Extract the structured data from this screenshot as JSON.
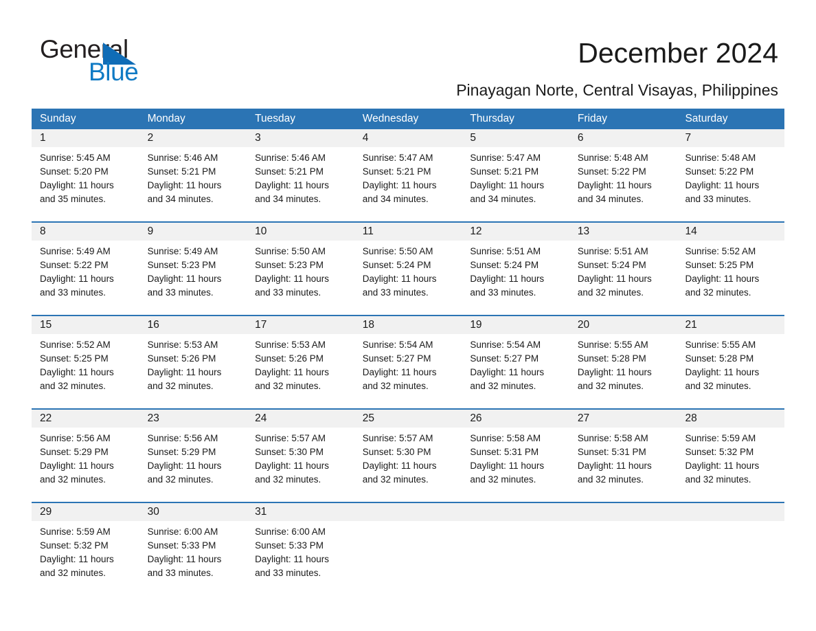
{
  "brand": {
    "logo_top": "General",
    "logo_bottom": "Blue",
    "accent_color": "#0f7ac4",
    "triangle_color": "#0f6cb6"
  },
  "header": {
    "title": "December 2024",
    "subtitle": "Pinayagan Norte, Central Visayas, Philippines"
  },
  "calendar": {
    "header_color": "#2b74b4",
    "date_band_color": "#f1f1f1",
    "weekdays": [
      "Sunday",
      "Monday",
      "Tuesday",
      "Wednesday",
      "Thursday",
      "Friday",
      "Saturday"
    ],
    "weeks": [
      [
        {
          "day": "1",
          "lines": [
            "Sunrise: 5:45 AM",
            "Sunset: 5:20 PM",
            "Daylight: 11 hours",
            "and 35 minutes."
          ]
        },
        {
          "day": "2",
          "lines": [
            "Sunrise: 5:46 AM",
            "Sunset: 5:21 PM",
            "Daylight: 11 hours",
            "and 34 minutes."
          ]
        },
        {
          "day": "3",
          "lines": [
            "Sunrise: 5:46 AM",
            "Sunset: 5:21 PM",
            "Daylight: 11 hours",
            "and 34 minutes."
          ]
        },
        {
          "day": "4",
          "lines": [
            "Sunrise: 5:47 AM",
            "Sunset: 5:21 PM",
            "Daylight: 11 hours",
            "and 34 minutes."
          ]
        },
        {
          "day": "5",
          "lines": [
            "Sunrise: 5:47 AM",
            "Sunset: 5:21 PM",
            "Daylight: 11 hours",
            "and 34 minutes."
          ]
        },
        {
          "day": "6",
          "lines": [
            "Sunrise: 5:48 AM",
            "Sunset: 5:22 PM",
            "Daylight: 11 hours",
            "and 34 minutes."
          ]
        },
        {
          "day": "7",
          "lines": [
            "Sunrise: 5:48 AM",
            "Sunset: 5:22 PM",
            "Daylight: 11 hours",
            "and 33 minutes."
          ]
        }
      ],
      [
        {
          "day": "8",
          "lines": [
            "Sunrise: 5:49 AM",
            "Sunset: 5:22 PM",
            "Daylight: 11 hours",
            "and 33 minutes."
          ]
        },
        {
          "day": "9",
          "lines": [
            "Sunrise: 5:49 AM",
            "Sunset: 5:23 PM",
            "Daylight: 11 hours",
            "and 33 minutes."
          ]
        },
        {
          "day": "10",
          "lines": [
            "Sunrise: 5:50 AM",
            "Sunset: 5:23 PM",
            "Daylight: 11 hours",
            "and 33 minutes."
          ]
        },
        {
          "day": "11",
          "lines": [
            "Sunrise: 5:50 AM",
            "Sunset: 5:24 PM",
            "Daylight: 11 hours",
            "and 33 minutes."
          ]
        },
        {
          "day": "12",
          "lines": [
            "Sunrise: 5:51 AM",
            "Sunset: 5:24 PM",
            "Daylight: 11 hours",
            "and 33 minutes."
          ]
        },
        {
          "day": "13",
          "lines": [
            "Sunrise: 5:51 AM",
            "Sunset: 5:24 PM",
            "Daylight: 11 hours",
            "and 32 minutes."
          ]
        },
        {
          "day": "14",
          "lines": [
            "Sunrise: 5:52 AM",
            "Sunset: 5:25 PM",
            "Daylight: 11 hours",
            "and 32 minutes."
          ]
        }
      ],
      [
        {
          "day": "15",
          "lines": [
            "Sunrise: 5:52 AM",
            "Sunset: 5:25 PM",
            "Daylight: 11 hours",
            "and 32 minutes."
          ]
        },
        {
          "day": "16",
          "lines": [
            "Sunrise: 5:53 AM",
            "Sunset: 5:26 PM",
            "Daylight: 11 hours",
            "and 32 minutes."
          ]
        },
        {
          "day": "17",
          "lines": [
            "Sunrise: 5:53 AM",
            "Sunset: 5:26 PM",
            "Daylight: 11 hours",
            "and 32 minutes."
          ]
        },
        {
          "day": "18",
          "lines": [
            "Sunrise: 5:54 AM",
            "Sunset: 5:27 PM",
            "Daylight: 11 hours",
            "and 32 minutes."
          ]
        },
        {
          "day": "19",
          "lines": [
            "Sunrise: 5:54 AM",
            "Sunset: 5:27 PM",
            "Daylight: 11 hours",
            "and 32 minutes."
          ]
        },
        {
          "day": "20",
          "lines": [
            "Sunrise: 5:55 AM",
            "Sunset: 5:28 PM",
            "Daylight: 11 hours",
            "and 32 minutes."
          ]
        },
        {
          "day": "21",
          "lines": [
            "Sunrise: 5:55 AM",
            "Sunset: 5:28 PM",
            "Daylight: 11 hours",
            "and 32 minutes."
          ]
        }
      ],
      [
        {
          "day": "22",
          "lines": [
            "Sunrise: 5:56 AM",
            "Sunset: 5:29 PM",
            "Daylight: 11 hours",
            "and 32 minutes."
          ]
        },
        {
          "day": "23",
          "lines": [
            "Sunrise: 5:56 AM",
            "Sunset: 5:29 PM",
            "Daylight: 11 hours",
            "and 32 minutes."
          ]
        },
        {
          "day": "24",
          "lines": [
            "Sunrise: 5:57 AM",
            "Sunset: 5:30 PM",
            "Daylight: 11 hours",
            "and 32 minutes."
          ]
        },
        {
          "day": "25",
          "lines": [
            "Sunrise: 5:57 AM",
            "Sunset: 5:30 PM",
            "Daylight: 11 hours",
            "and 32 minutes."
          ]
        },
        {
          "day": "26",
          "lines": [
            "Sunrise: 5:58 AM",
            "Sunset: 5:31 PM",
            "Daylight: 11 hours",
            "and 32 minutes."
          ]
        },
        {
          "day": "27",
          "lines": [
            "Sunrise: 5:58 AM",
            "Sunset: 5:31 PM",
            "Daylight: 11 hours",
            "and 32 minutes."
          ]
        },
        {
          "day": "28",
          "lines": [
            "Sunrise: 5:59 AM",
            "Sunset: 5:32 PM",
            "Daylight: 11 hours",
            "and 32 minutes."
          ]
        }
      ],
      [
        {
          "day": "29",
          "lines": [
            "Sunrise: 5:59 AM",
            "Sunset: 5:32 PM",
            "Daylight: 11 hours",
            "and 32 minutes."
          ]
        },
        {
          "day": "30",
          "lines": [
            "Sunrise: 6:00 AM",
            "Sunset: 5:33 PM",
            "Daylight: 11 hours",
            "and 33 minutes."
          ]
        },
        {
          "day": "31",
          "lines": [
            "Sunrise: 6:00 AM",
            "Sunset: 5:33 PM",
            "Daylight: 11 hours",
            "and 33 minutes."
          ]
        },
        {
          "day": "",
          "lines": []
        },
        {
          "day": "",
          "lines": []
        },
        {
          "day": "",
          "lines": []
        },
        {
          "day": "",
          "lines": []
        }
      ]
    ]
  }
}
